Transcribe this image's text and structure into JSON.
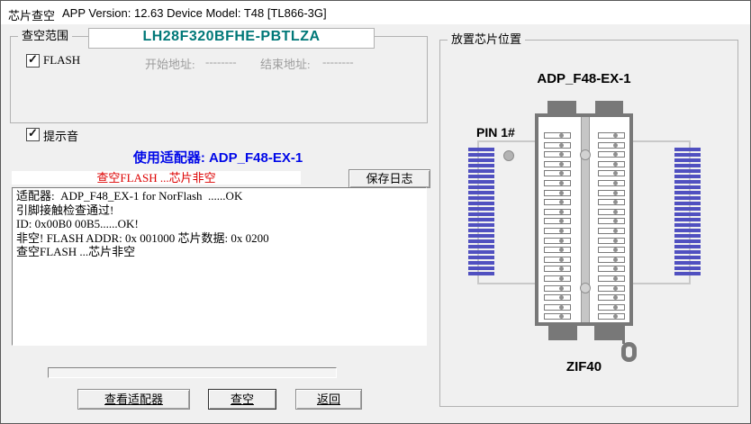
{
  "window": {
    "title": "芯片查空",
    "app_info": "APP Version: 12.63 Device Model: T48 [TL866-3G]"
  },
  "blank_check_group": {
    "title": "查空范围",
    "chip_name": "LH28F320BFHE-PBTLZA",
    "flash_checkbox": {
      "label": "FLASH",
      "checked": true
    },
    "start_address_label": "开始地址:",
    "start_address_value": "--------",
    "end_address_label": "结束地址:",
    "end_address_value": "--------"
  },
  "beep_checkbox": {
    "label": "提示音",
    "checked": true
  },
  "adapter_line": "使用适配器: ADP_F48-EX-1",
  "status_message": "查空FLASH ...芯片非空",
  "toolbar": {
    "save_log_label": "保存日志"
  },
  "log": {
    "lines": [
      "适配器:  ADP_F48_EX-1 for NorFlash  ......OK",
      "引脚接触检查通过!",
      "ID: 0x00B0 00B5......OK!",
      "非空! FLASH ADDR: 0x 001000 芯片数据: 0x 0200",
      "查空FLASH ...芯片非空"
    ]
  },
  "progress_percent": 0,
  "buttons": {
    "view_adapter": "查看适配器",
    "blank_check": "查空",
    "back": "返回"
  },
  "placement_group": {
    "title": "放置芯片位置",
    "adapter_name": "ADP_F48-EX-1",
    "pin1_label": "PIN 1#",
    "socket_label": "ZIF40",
    "pin_rows_per_side": 24,
    "slots_per_column": 20
  },
  "colors": {
    "chip_name_teal": "#007878",
    "adapter_blue": "#0008e8",
    "status_red": "#dd0000",
    "pin_bar_blue": "#5050c0",
    "socket_gray": "#787878",
    "disabled_text": "#9d9d9d"
  }
}
